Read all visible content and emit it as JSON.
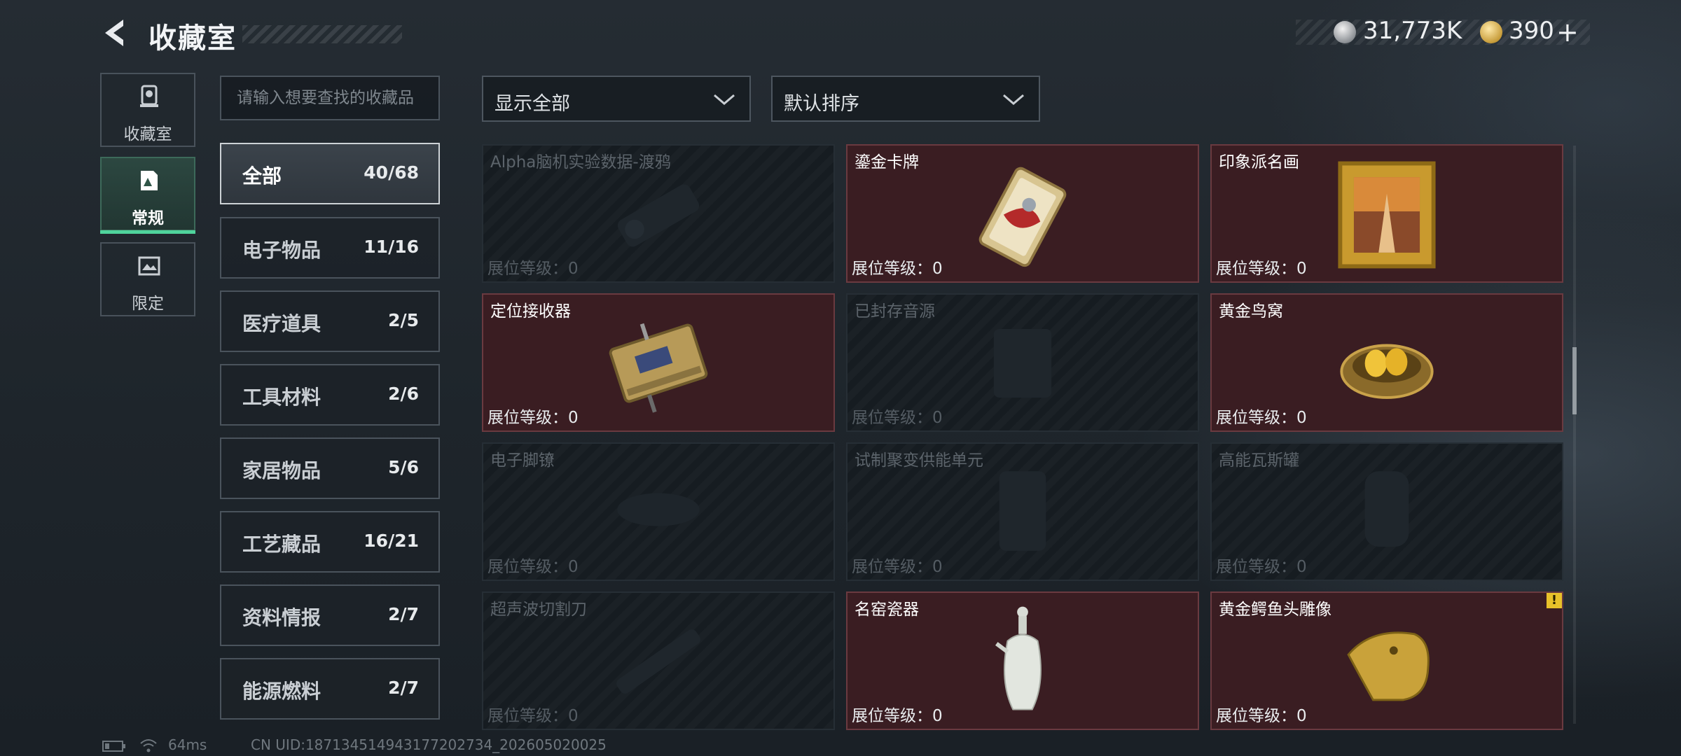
{
  "header": {
    "title": "收藏室",
    "back_icon": "back-arrow-icon",
    "currency": {
      "silver_value": "31,773K",
      "gold_value": "390",
      "plus_label": "+"
    }
  },
  "side_tabs": [
    {
      "label": "收藏室",
      "icon": "collection-room-icon"
    },
    {
      "label": "常规",
      "icon": "regular-icon",
      "active": true
    },
    {
      "label": "限定",
      "icon": "limited-icon"
    }
  ],
  "search": {
    "placeholder": "请输入想要查找的收藏品"
  },
  "categories": [
    {
      "name": "全部",
      "count": "40/68",
      "active": true
    },
    {
      "name": "电子物品",
      "count": "11/16"
    },
    {
      "name": "医疗道具",
      "count": "2/5"
    },
    {
      "name": "工具材料",
      "count": "2/6"
    },
    {
      "name": "家居物品",
      "count": "5/6"
    },
    {
      "name": "工艺藏品",
      "count": "16/21"
    },
    {
      "name": "资料情报",
      "count": "2/7"
    },
    {
      "name": "能源燃料",
      "count": "2/7"
    }
  ],
  "filters": {
    "display": "显示全部",
    "sort": "默认排序"
  },
  "items": [
    {
      "name": "Alpha脑机实验数据-渡鸦",
      "level": "展位等级：0",
      "owned": false
    },
    {
      "name": "鎏金卡牌",
      "level": "展位等级：0",
      "owned": true
    },
    {
      "name": "印象派名画",
      "level": "展位等级：0",
      "owned": true
    },
    {
      "name": "定位接收器",
      "level": "展位等级：0",
      "owned": true
    },
    {
      "name": "已封存音源",
      "level": "展位等级：0",
      "owned": false
    },
    {
      "name": "黄金鸟窝",
      "level": "展位等级：0",
      "owned": true
    },
    {
      "name": "电子脚镣",
      "level": "展位等级：0",
      "owned": false
    },
    {
      "name": "试制聚变供能单元",
      "level": "展位等级：0",
      "owned": false
    },
    {
      "name": "高能瓦斯罐",
      "level": "展位等级：0",
      "owned": false
    },
    {
      "name": "超声波切割刀",
      "level": "展位等级：0",
      "owned": false
    },
    {
      "name": "名窑瓷器",
      "level": "展位等级：0",
      "owned": true
    },
    {
      "name": "黄金鳄鱼头雕像",
      "level": "展位等级：0",
      "owned": true,
      "badge": "!"
    }
  ],
  "footer": {
    "ping": "64ms",
    "uid": "CN UID:187134514943177202734_202605020025"
  },
  "colors": {
    "accent_green": "#4fd39b",
    "owned_card": "#3a1d22",
    "locked_card": "#161c21",
    "warn_badge": "#e8c12a"
  }
}
